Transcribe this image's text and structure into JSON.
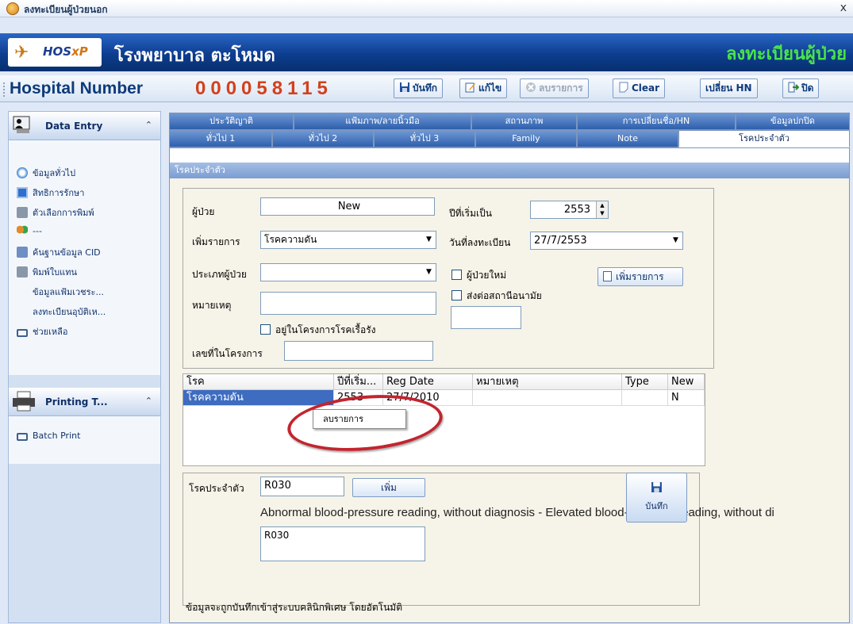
{
  "window": {
    "title": "ลงทะเบียนผู้ป่วยนอก",
    "close_glyph": "x"
  },
  "banner": {
    "logo_text": "HOS",
    "logo_xp": "xP",
    "hospital_name": "โรงพยาบาล ตะโหมด",
    "module_title": "ลงทะเบียนผู้ป่วย"
  },
  "hnbar": {
    "label": "Hospital Number",
    "hn": "000058115",
    "buttons": {
      "save": "บันทึก",
      "edit": "แก้ไข",
      "delete": "ลบรายการ",
      "clear": "Clear",
      "change_hn": "เปลี่ยน HN",
      "close": "ปิด"
    }
  },
  "sidebar": {
    "data_entry": {
      "title": "Data Entry",
      "items": [
        {
          "label": "ข้อมูลทั่วไป",
          "icon": "globe-icon"
        },
        {
          "label": "สิทธิการรักษา",
          "icon": "card-icon"
        },
        {
          "label": "ตัวเลือกการพิมพ์",
          "icon": "printer-options-icon"
        },
        {
          "label": "---",
          "icon": "users-icon"
        },
        {
          "label": "ค้นฐานข้อมูล CID",
          "icon": "database-search-icon"
        },
        {
          "label": "พิมพ์ใบแทน",
          "icon": "print-icon"
        },
        {
          "label": "ข้อมูลแฟ้มเวชระ...",
          "icon": ""
        },
        {
          "label": "ลงทะเบียนอุบัติเห...",
          "icon": ""
        },
        {
          "label": "ช่วยเหลือ",
          "icon": "help-icon"
        }
      ]
    },
    "printing": {
      "title": "Printing T...",
      "items": [
        {
          "label": "Batch Print",
          "icon": "batch-print-icon"
        }
      ]
    }
  },
  "tabs": {
    "row1": [
      "ประวัติญาติ",
      "แฟ้มภาพ/ลายนิ้วมือ",
      "สถานภาพ",
      "การเปลี่ยนชื่อ/HN",
      "ข้อมูลปกปิด"
    ],
    "row2": [
      "ทั่วไป 1",
      "ทั่วไป 2",
      "ทั่วไป 3",
      "Family",
      "Note",
      "โรคประจำตัว"
    ],
    "active": "โรคประจำตัว"
  },
  "section": {
    "title": "โรคประจำตัว"
  },
  "form": {
    "patient_label": "ผู้ป่วย",
    "patient_value": "New",
    "add_item_label": "เพิ่มรายการ",
    "add_item_value": "โรคความดัน",
    "patient_type_label": "ประเภทผู้ป่วย",
    "patient_type_value": "",
    "remark_label": "หมายเหตุ",
    "remark_value": "",
    "chronic_program_label": "อยู่ในโครงการโรคเรื้อรัง",
    "program_no_label": "เลขที่ในโครงการ",
    "program_no_value": "",
    "start_year_label": "ปีที่เริ่มเป็น",
    "start_year_value": "2553",
    "reg_date_label": "วันที่ลงทะเบียน",
    "reg_date_value": "27/7/2553",
    "new_patient_label": "ผู้ป่วยใหม่",
    "refer_label": "ส่งต่อสถานีอนามัย",
    "refer_value": "",
    "add_button": "เพิ่มรายการ"
  },
  "grid": {
    "columns": [
      "โรค",
      "ปีที่เริ่ม...",
      "Reg Date",
      "หมายเหตุ",
      "Type",
      "New"
    ],
    "rows": [
      [
        "โรคความดัน",
        "2553",
        "27/7/2010",
        "",
        "",
        "N"
      ]
    ]
  },
  "context_menu": {
    "item": "ลบรายการ"
  },
  "icd": {
    "label": "โรคประจำตัว",
    "code_value": "R030",
    "add_button": "เพิ่ม",
    "description": "Abnormal blood-pressure reading, without diagnosis - Elevated blood-pressure reading, without di",
    "list_value": "R030",
    "save_button": "บันทึก"
  },
  "footer_note": "ข้อมูลจะถูกบันทึกเข้าสู่ระบบคลินิกพิเศษ โดยอัตโนมัติ"
}
